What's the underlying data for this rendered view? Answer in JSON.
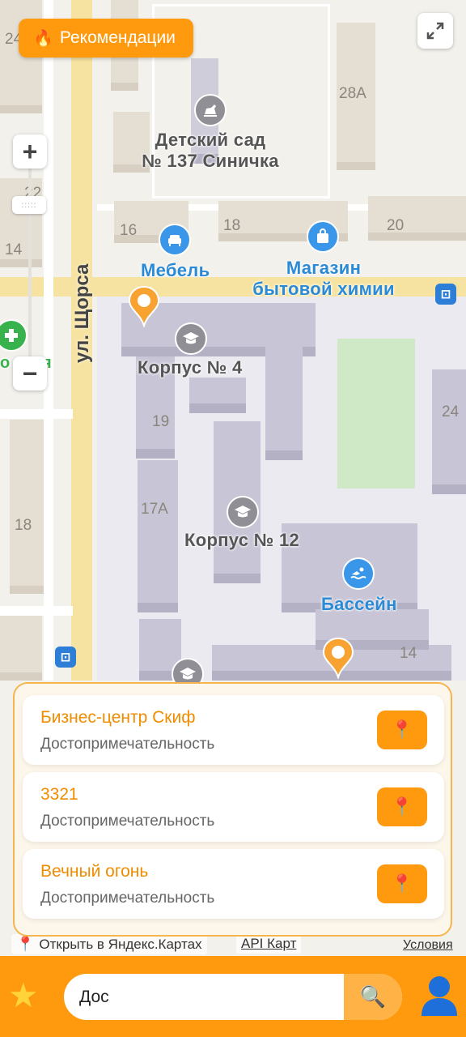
{
  "map": {
    "recommendations_label": "Рекомендации",
    "street_name": "ул. Щорса",
    "labels": {
      "kindergarten": "Детский сад\n№ 137 Синичка",
      "furniture": "Мебель",
      "shop": "Магазин\nбытовой химии",
      "korpus4": "Корпус № 4",
      "korpus12": "Корпус № 12",
      "pool": "Бассейн",
      "cut_label": "я"
    },
    "house_numbers": {
      "n24_top": "24",
      "n28a": "28А",
      "n16": "16",
      "n18_top": "18",
      "n20": "20",
      "n14_left": "14",
      "n19": "19",
      "n24_right": "24",
      "n17a": "17А",
      "n18_left": "18",
      "n14_bottom": "14",
      "n22": "22"
    },
    "icons": {
      "flame": "flame-icon",
      "expand": "expand-icon",
      "zoom_in": "+",
      "zoom_out": "−"
    }
  },
  "footer": {
    "open_in_yandex": "Открыть в Яндекс.Картах",
    "api": "API Карт",
    "terms": "Условия"
  },
  "results": [
    {
      "title": "Бизнес-центр Скиф",
      "subtitle": "Достопримечательность"
    },
    {
      "title": "3321",
      "subtitle": "Достопримечательность"
    },
    {
      "title": "Вечный огонь",
      "subtitle": "Достопримечательность"
    }
  ],
  "search": {
    "value": "Дос"
  },
  "colors": {
    "accent": "#ff9a0e",
    "title_orange": "#f08c00",
    "poi_blue": "#3a96e8"
  }
}
